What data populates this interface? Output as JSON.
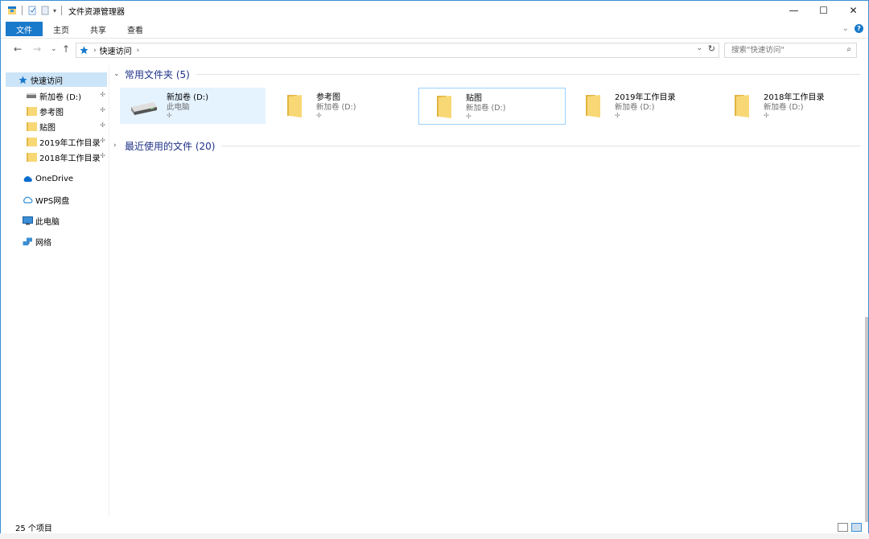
{
  "window": {
    "title": "文件资源管理器",
    "min_glyph": "—",
    "max_glyph": "☐",
    "close_glyph": "✕"
  },
  "ribbon": {
    "tabs": [
      "文件",
      "主页",
      "共享",
      "查看"
    ],
    "expand_glyph": "⌄",
    "help_glyph": "?"
  },
  "nav": {
    "back": "←",
    "forward": "→",
    "recent": "⌄",
    "up": "↑"
  },
  "address": {
    "location": "快速访问",
    "sep": "›",
    "dropdown": "⌄",
    "refresh": "↻"
  },
  "search": {
    "placeholder": "搜索\"快速访问\"",
    "icon": "⌕"
  },
  "sidebar": {
    "quick_access": "快速访问",
    "pinned": [
      {
        "label": "新加卷 (D:)",
        "icon": "drive-icon"
      },
      {
        "label": "参考图",
        "icon": "folder-icon"
      },
      {
        "label": "贴图",
        "icon": "folder-icon"
      },
      {
        "label": "2019年工作目录",
        "icon": "folder-icon"
      },
      {
        "label": "2018年工作目录",
        "icon": "folder-icon"
      }
    ],
    "pin_glyph": "📌",
    "onedrive": "OneDrive",
    "wps": "WPS网盘",
    "this_pc": "此电脑",
    "network": "网络"
  },
  "main": {
    "frequent_header": "常用文件夹 (5)",
    "frequent_chevron": "⌄",
    "recent_header": "最近使用的文件 (20)",
    "recent_chevron": "›",
    "tiles": [
      {
        "name": "新加卷 (D:)",
        "sub": "此电脑",
        "icon": "drive-icon"
      },
      {
        "name": "参考图",
        "sub": "新加卷 (D:)",
        "icon": "folder-icon"
      },
      {
        "name": "贴图",
        "sub": "新加卷 (D:)",
        "icon": "folder-icon"
      },
      {
        "name": "2019年工作目录",
        "sub": "新加卷 (D:)",
        "icon": "folder-icon"
      },
      {
        "name": "2018年工作目录",
        "sub": "新加卷 (D:)",
        "icon": "folder-icon"
      }
    ],
    "tile_pin": "📌"
  },
  "status": {
    "count": "25 个项目"
  },
  "colors": {
    "accent": "#1979ca",
    "folder": "#f8d775",
    "selection": "#cce4f7",
    "group_header": "#1e3287"
  }
}
